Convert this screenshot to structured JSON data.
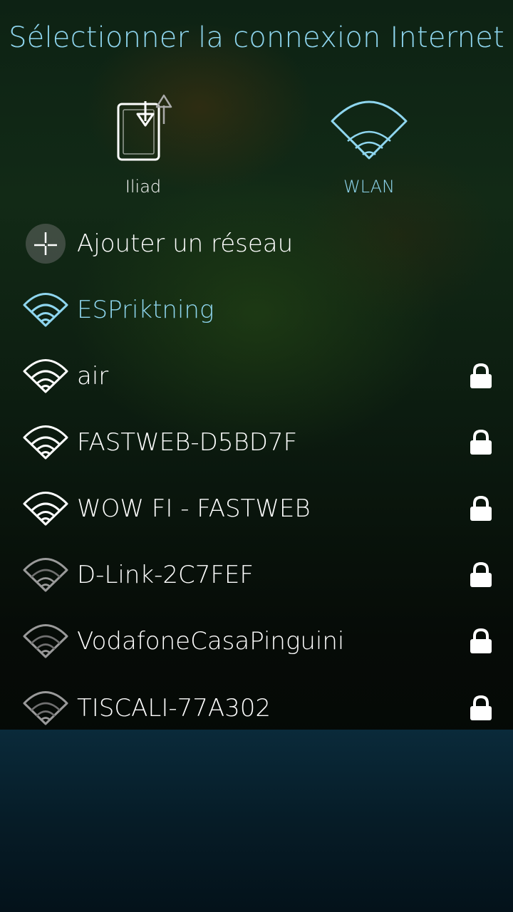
{
  "page": {
    "title": "Sélectionner la connexion Internet"
  },
  "connection_types": [
    {
      "label": "Iliad",
      "icon": "mobile-data-icon"
    },
    {
      "label": "WLAN",
      "icon": "wlan-icon",
      "selected": true
    }
  ],
  "add_network": {
    "label": "Ajouter un réseau",
    "icon": "add-icon"
  },
  "networks": [
    {
      "name": "ESPriktning",
      "highlighted": true,
      "signal": "strong",
      "secured": false
    },
    {
      "name": "air",
      "signal": "strong",
      "secured": true
    },
    {
      "name": "FASTWEB-D5BD7F",
      "signal": "strong",
      "secured": true
    },
    {
      "name": "WOW FI - FASTWEB",
      "signal": "strong",
      "secured": true
    },
    {
      "name": "D-Link-2C7FEF",
      "signal": "weak",
      "secured": true
    },
    {
      "name": "VodafoneCasaPinguini",
      "signal": "weak",
      "secured": true
    },
    {
      "name": "TISCALI-77A302",
      "signal": "weak",
      "secured": true
    }
  ],
  "colors": {
    "accent": "#8fd6ef",
    "text": "#ffffff",
    "weak_signal": "#9a9a9a"
  }
}
